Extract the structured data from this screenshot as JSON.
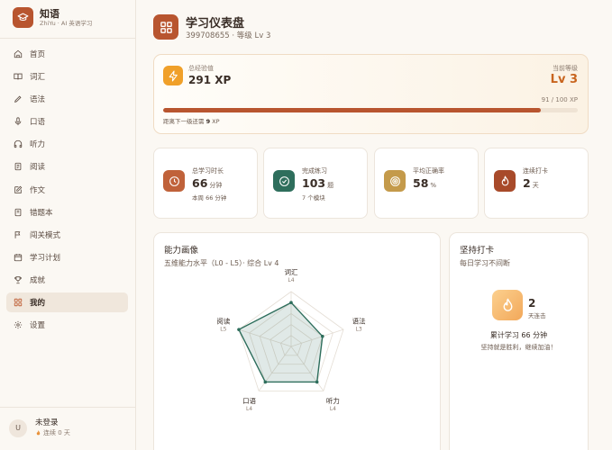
{
  "brand": {
    "name": "知语",
    "subtitle": "ZhiYu · AI 英语学习",
    "logo_icon": "graduation-cap-icon"
  },
  "nav": {
    "items": [
      {
        "label": "首页",
        "icon": "home-icon"
      },
      {
        "label": "词汇",
        "icon": "book-icon"
      },
      {
        "label": "语法",
        "icon": "pen-icon"
      },
      {
        "label": "口语",
        "icon": "mic-icon"
      },
      {
        "label": "听力",
        "icon": "headphones-icon"
      },
      {
        "label": "阅读",
        "icon": "document-icon"
      },
      {
        "label": "作文",
        "icon": "edit-icon"
      },
      {
        "label": "错题本",
        "icon": "notebook-icon"
      },
      {
        "label": "闯关模式",
        "icon": "flag-icon"
      },
      {
        "label": "学习计划",
        "icon": "calendar-icon"
      },
      {
        "label": "成就",
        "icon": "trophy-icon"
      },
      {
        "label": "我的",
        "icon": "grid-icon"
      },
      {
        "label": "设置",
        "icon": "gear-icon"
      }
    ],
    "active_index": 11
  },
  "user": {
    "avatar_letter": "U",
    "name": "未登录",
    "streak": "连续 0 天"
  },
  "header": {
    "title": "学习仪表盘",
    "subtitle": "399708655 · 等级 Lv 3"
  },
  "xp": {
    "label": "总经验值",
    "value": "291 XP",
    "level_label": "当前等级",
    "level_value": "Lv 3",
    "progress_text": "91 / 100 XP",
    "progress_fraction": 0.91,
    "next_prefix": "距离下一级还需 ",
    "next_amount": "9",
    "next_suffix": " XP"
  },
  "stats": [
    {
      "label": "总学习时长",
      "value": "66",
      "unit": "分钟",
      "sub": "本周 66 分钟",
      "icon": "clock-icon",
      "color": "#c0623a"
    },
    {
      "label": "完成练习",
      "value": "103",
      "unit": "题",
      "sub": "7 个模块",
      "icon": "check-circle-icon",
      "color": "#2e6e5c"
    },
    {
      "label": "平均正确率",
      "value": "58",
      "unit": "%",
      "sub": "",
      "icon": "target-icon",
      "color": "#c49a4a"
    },
    {
      "label": "连续打卡",
      "value": "2",
      "unit": "天",
      "sub": "",
      "icon": "flame-icon",
      "color": "#a84a2a"
    }
  ],
  "radar": {
    "title": "能力画像",
    "subtitle": "五维能力水平（L0 - L5）· 综合 Lv 4",
    "axes": [
      {
        "name": "词汇",
        "level": "L4",
        "value": 4
      },
      {
        "name": "语法",
        "level": "L3",
        "value": 3
      },
      {
        "name": "听力",
        "level": "L4",
        "value": 4
      },
      {
        "name": "口语",
        "level": "L4",
        "value": 4
      },
      {
        "name": "阅读",
        "level": "L5",
        "value": 5
      }
    ],
    "max": 5,
    "color": "#2e6e5c"
  },
  "streak": {
    "title": "坚持打卡",
    "subtitle": "每日学习不间断",
    "days": "2",
    "unit": "天连击",
    "total": "累计学习 66 分钟",
    "message": "坚持就是胜利，继续加油！",
    "icon": "flame-icon"
  }
}
